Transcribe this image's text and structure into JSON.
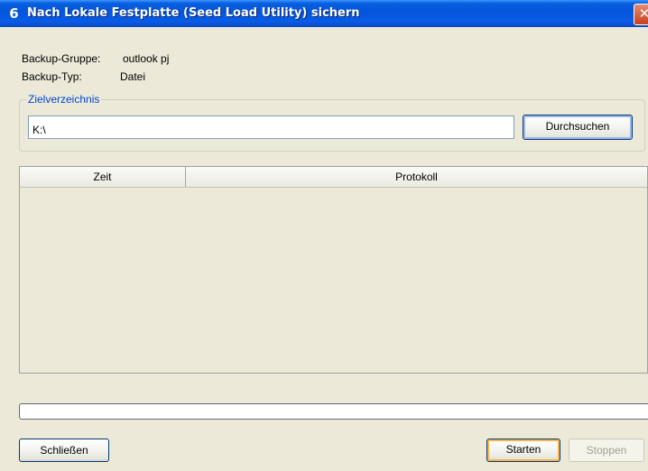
{
  "window": {
    "title": "Nach Lokale Festplatte (Seed Load Utility) sichern",
    "app_icon_glyph": "6",
    "close_glyph": "✕"
  },
  "info": {
    "group_label": "Backup-Gruppe:",
    "group_value": "outlook pj",
    "type_label": "Backup-Typ:",
    "type_value": "Datei"
  },
  "target_dir": {
    "legend": "Zielverzeichnis",
    "value": "K:\\",
    "browse_label": "Durchsuchen"
  },
  "log_table": {
    "columns": [
      "Zeit",
      "Protokoll"
    ],
    "rows": []
  },
  "progress": {
    "fraction": 0
  },
  "buttons": {
    "close_label": "Schließen",
    "start_label": "Starten",
    "stop_label": "Stoppen"
  }
}
